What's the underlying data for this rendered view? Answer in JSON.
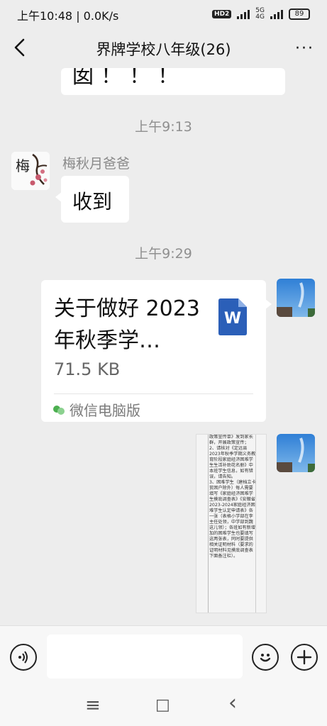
{
  "status": {
    "time_speed": "上午10:48 | 0.0K/s",
    "hd_badge": "HD2",
    "net_top": "5G",
    "net_bottom": "4G",
    "battery": "89"
  },
  "header": {
    "title": "界牌学校八年级(26)",
    "more_label": "···"
  },
  "messages": {
    "prev_bubble_text": "囡！！！",
    "time1": "上午9:13",
    "sender1": "梅秋月爸爸",
    "reply_text": "收到",
    "time2": "上午9:29",
    "file": {
      "name": "关于做好 2023 年秋季学…",
      "size": "71.5 KB",
      "source": "微信电脑版",
      "type_letter": "W"
    },
    "image_doc_text": "政策宣传单》发到家长群，开展政策宣传；\n2、请核对《定远县2023年秋季学期义务教育阶段家庭经济困难学生生活补助花名册》中本班学生信息，如有错误，请告知。\n3、困难学生（建档立卡贫困户除外）每人需要填写《家庭经济困难学生摸底调查表》《安徽省2023-2024家庭经济困难学生认定申请表》各一张（表格小学部在李主任处领，中学部到魏这儿领）；各班如有新增加的困难学生也要填写这两张表，同时要提供相关证明材料（要求的证明材料见摸底调查表下面备注栏）。",
    "avatar_char": "梅"
  },
  "input": {
    "placeholder": ""
  },
  "nav": {
    "menu": "≡",
    "home": "□",
    "back": "‹"
  },
  "colors": {
    "chat_bg": "#ededed",
    "bubble": "#ffffff",
    "word_blue": "#2b5fb8",
    "wechat_green": "#4caf50"
  }
}
